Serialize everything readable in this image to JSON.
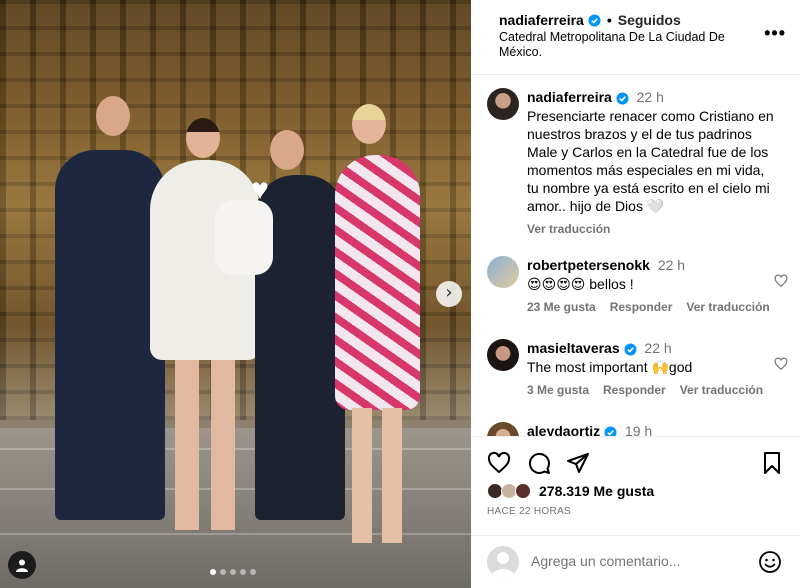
{
  "photo": {
    "carousel_dots": 5,
    "active_dot": 0
  },
  "header": {
    "username": "nadiaferreira",
    "separator": "•",
    "following_label": "Seguidos",
    "location": "Catedral Metropolitana De La Ciudad De México."
  },
  "caption": {
    "username": "nadiaferreira",
    "time": "22 h",
    "text": "Presenciarte renacer como Cristiano en nuestros brazos y el de tus padrinos Male y Carlos en la Catedral fue de los momentos más especiales en mi vida, tu nombre ya está escrito en el cielo mi amor.. hijo de Dios 🤍",
    "translate_label": "Ver traducción"
  },
  "comments": [
    {
      "username": "robertpetersenokk",
      "time": "22 h",
      "text": "😍😍😍😍 bellos !",
      "likes": "23 Me gusta",
      "reply": "Responder",
      "translate": "Ver traducción"
    },
    {
      "username": "masieltaveras",
      "time": "22 h",
      "text": "The most important 🙌god",
      "likes": "3 Me gusta",
      "reply": "Responder",
      "translate": "Ver traducción"
    },
    {
      "username": "aleydaortiz",
      "time": "19 h"
    }
  ],
  "actions": {
    "likes_count": "278.319 Me gusta",
    "posted_ago": "HACE 22 HORAS"
  },
  "add_comment": {
    "placeholder": "Agrega un comentario..."
  },
  "colors": {
    "verified": "#0095f6",
    "secondary_text": "#737373",
    "divider": "#efefef"
  },
  "icons": [
    "heart-icon",
    "comment-icon",
    "share-icon",
    "bookmark-icon",
    "emoji-icon",
    "more-icon",
    "chevron-right-icon",
    "user-tag-icon",
    "verified-icon"
  ]
}
